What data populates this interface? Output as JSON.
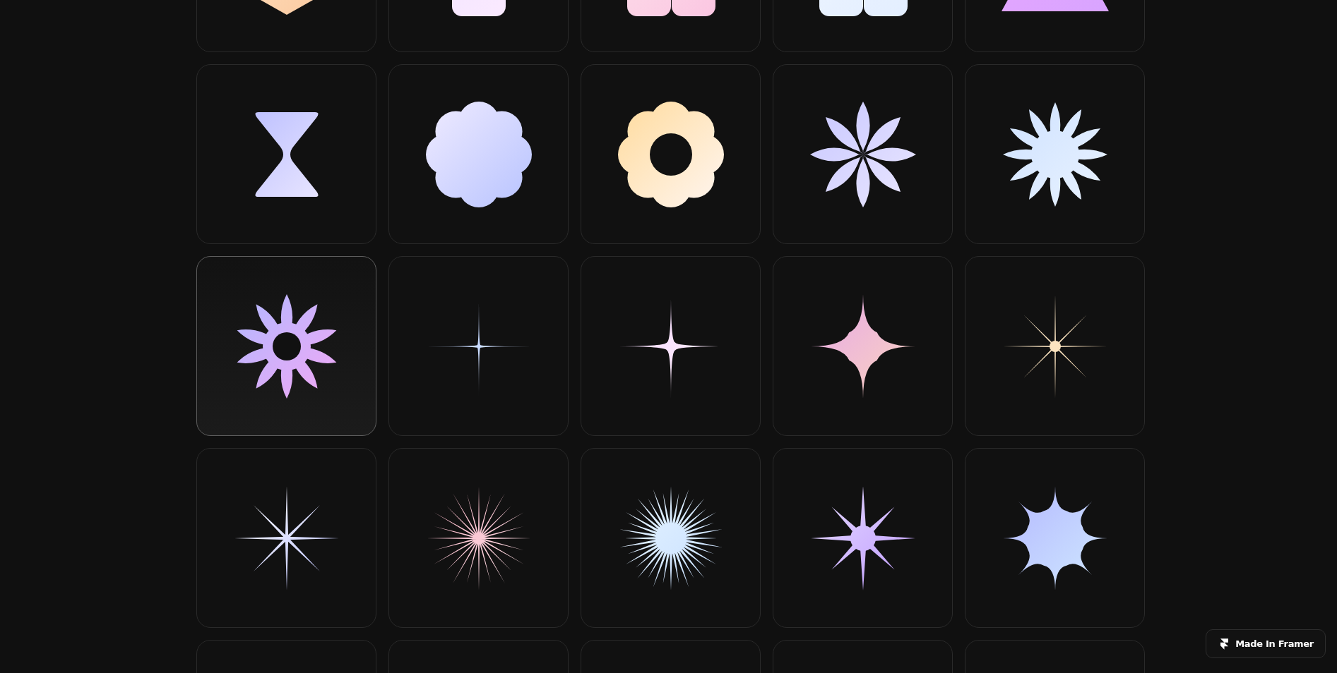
{
  "rows": [
    {
      "cards": [
        {
          "kind": "diamond",
          "selected": false
        },
        {
          "kind": "rounded-square",
          "selected": false
        },
        {
          "kind": "double-pill-pink",
          "selected": false
        },
        {
          "kind": "double-pill-blue",
          "selected": false
        },
        {
          "kind": "triangle",
          "selected": false
        }
      ]
    },
    {
      "cards": [
        {
          "kind": "hourglass",
          "selected": false
        },
        {
          "kind": "scallop",
          "selected": false
        },
        {
          "kind": "scallop-ring",
          "selected": false
        },
        {
          "kind": "flower-8",
          "selected": false
        },
        {
          "kind": "flower-12",
          "selected": false
        }
      ]
    },
    {
      "cards": [
        {
          "kind": "flower-ring",
          "selected": true
        },
        {
          "kind": "sparkle-thin",
          "selected": false
        },
        {
          "kind": "sparkle",
          "selected": false
        },
        {
          "kind": "sparkle-fat",
          "selected": false
        },
        {
          "kind": "ray-star",
          "selected": false
        }
      ]
    },
    {
      "cards": [
        {
          "kind": "line-star",
          "selected": false
        },
        {
          "kind": "line-burst",
          "selected": false
        },
        {
          "kind": "dense-burst",
          "selected": false
        },
        {
          "kind": "spiky-star",
          "selected": false
        },
        {
          "kind": "badge",
          "selected": false
        }
      ]
    },
    {
      "cards": [
        {
          "selected": false
        },
        {
          "selected": false
        },
        {
          "selected": false
        },
        {
          "selected": false
        },
        {
          "selected": false
        }
      ]
    }
  ],
  "badge": {
    "label": "Made In Framer"
  }
}
